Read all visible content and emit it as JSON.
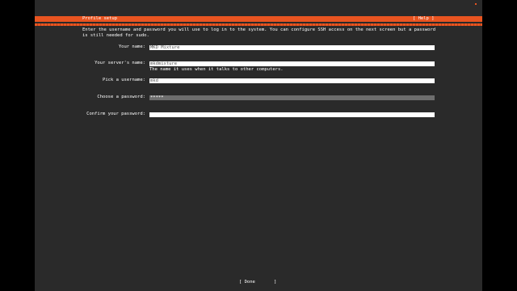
{
  "header": {
    "title": "Profile setup",
    "help_label": "[ Help ]"
  },
  "intro": "Enter the username and password you will use to log in to the system. You can configure SSH access on the next screen but a password is still needed for sudo.",
  "form": {
    "name_label": "Your name:",
    "name_value": "MKD Mixture",
    "server_label": "Your server's name:",
    "server_value": "mkdmixture",
    "server_hint": "The name it uses when it talks to other computers.",
    "username_label": "Pick a username:",
    "username_value": "mkd",
    "password_label": "Choose a password:",
    "password_value": "*****",
    "confirm_label": "Confirm your password:",
    "confirm_value": ""
  },
  "footer": {
    "done_label": "[ Done       ]"
  },
  "colors": {
    "accent": "#e95420",
    "background": "#2a2a2a",
    "field_active": "#6e6e6e"
  }
}
